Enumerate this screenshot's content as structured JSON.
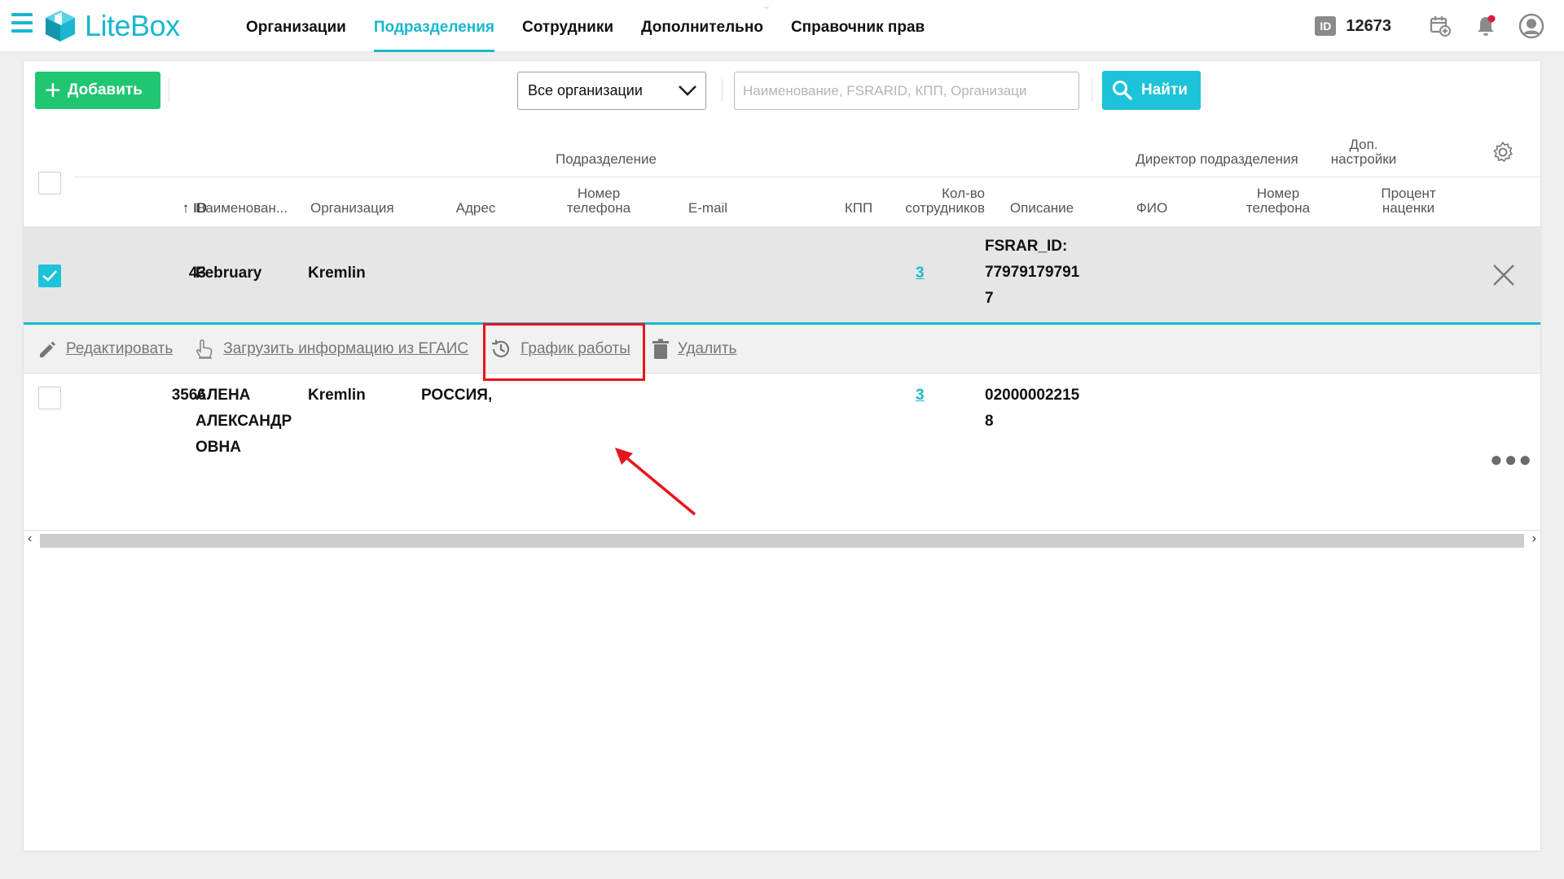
{
  "app": {
    "name": "LiteBox"
  },
  "nav": {
    "items": [
      "Организации",
      "Подразделения",
      "Сотрудники",
      "Дополнительно",
      "Справочник прав"
    ],
    "active_index": 1
  },
  "user": {
    "id_badge": "ID",
    "id_number": "12673"
  },
  "toolbar": {
    "add_label": "Добавить",
    "org_select_value": "Все организации",
    "search_placeholder": "Наименование, FSRARID, КПП, Организаци",
    "find_label": "Найти"
  },
  "table": {
    "group_headers": {
      "division": "Подразделение",
      "director": "Директор подразделения",
      "extra_settings": "Доп. настройки"
    },
    "columns": {
      "id": "ID",
      "name": "Наименован...",
      "organization": "Организация",
      "address": "Адрес",
      "phone": "Номер телефона",
      "email": "E-mail",
      "kpp": "КПП",
      "employee_count": "Кол-во сотрудников",
      "description": "Описание",
      "director_name": "ФИО",
      "director_phone": "Номер телефона",
      "markup_percent": "Процент наценки"
    },
    "rows": [
      {
        "id": "43",
        "name": "February",
        "organization": "Kremlin",
        "address": "",
        "employee_count": "3",
        "description_lines": [
          "FSRAR_ID:",
          "77979179791",
          "7"
        ],
        "selected": true
      },
      {
        "id": "3566",
        "name_lines": [
          "АЛЕНА",
          "АЛЕКСАНДР",
          "ОВНА"
        ],
        "organization": "Kremlin",
        "address": "РОССИЯ,",
        "employee_count": "3",
        "description_lines": [
          "02000002215",
          "8"
        ],
        "selected": false
      }
    ],
    "actions": {
      "edit": "Редактировать",
      "load_egais": "Загрузить информацию из ЕГАИС",
      "schedule": "График работы",
      "delete": "Удалить"
    }
  },
  "colors": {
    "accent": "#1ab7cf",
    "add_button": "#20c671",
    "find_button": "#1cc3d9",
    "highlight": "#e8141c"
  }
}
